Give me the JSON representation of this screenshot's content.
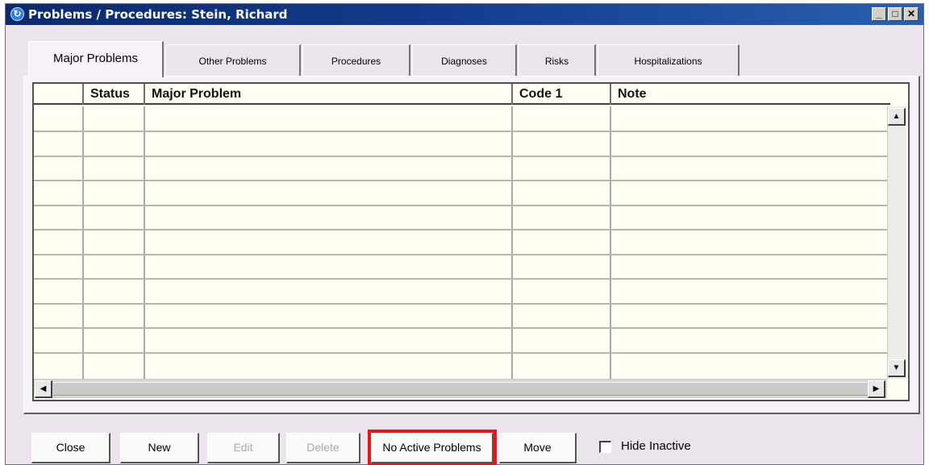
{
  "window": {
    "title": "Problems / Procedures: Stein, Richard",
    "app_icon": "refresh-logo-icon",
    "controls": {
      "minimize": "_",
      "maximize": "□",
      "close": "✕"
    }
  },
  "tabs": [
    {
      "label": "Major Problems",
      "active": true
    },
    {
      "label": "Other Problems",
      "active": false
    },
    {
      "label": "Procedures",
      "active": false
    },
    {
      "label": "Diagnoses",
      "active": false
    },
    {
      "label": "Risks",
      "active": false
    },
    {
      "label": "Hospitalizations",
      "active": false
    }
  ],
  "grid": {
    "columns": [
      "",
      "Status",
      "Major Problem",
      "Code 1",
      "Note"
    ],
    "rows": [],
    "scroll": {
      "up": "▲",
      "down": "▼",
      "left": "◀",
      "right": "▶"
    }
  },
  "buttons": {
    "close": "Close",
    "new": "New",
    "edit": "Edit",
    "delete": "Delete",
    "no_active": "No Active Problems",
    "move": "Move"
  },
  "hide_inactive": {
    "label": "Hide Inactive",
    "checked": false
  },
  "colors": {
    "highlight": "#e01818",
    "title_bar": "#0c2a6e",
    "grid_bg": "#fffff3"
  }
}
